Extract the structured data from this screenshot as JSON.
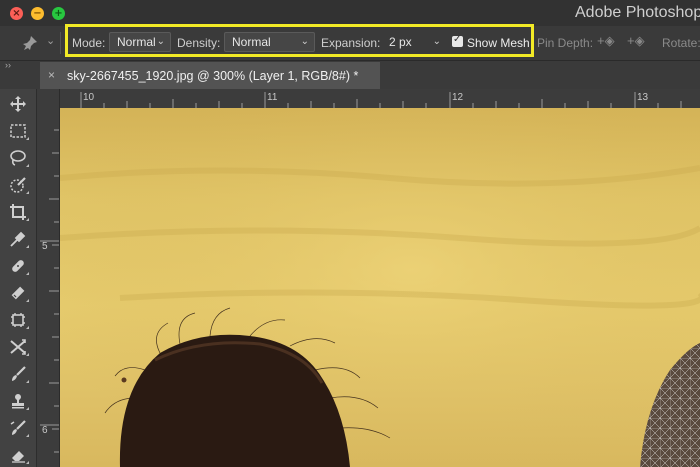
{
  "window": {
    "title": "Adobe Photoshop C"
  },
  "options_bar": {
    "mode_label": "Mode:",
    "mode_value": "Normal",
    "density_label": "Density:",
    "density_value": "Normal",
    "expansion_label": "Expansion:",
    "expansion_value": "2 px",
    "show_mesh_label": "Show Mesh",
    "show_mesh_checked": true,
    "pin_depth_label": "Pin Depth:",
    "rotate_label": "Rotate:",
    "highlight_color": "#f2ea26"
  },
  "document_tab": {
    "close_glyph": "×",
    "title": "sky-2667455_1920.jpg @ 300% (Layer 1, RGB/8#) *"
  },
  "rulers": {
    "horizontal": [
      "10",
      "11",
      "12",
      "13"
    ],
    "vertical": [
      "5",
      "6"
    ]
  },
  "tools": [
    "move-icon",
    "marquee-icon",
    "lasso-icon",
    "quick-select-icon",
    "crop-icon",
    "eyedropper-icon",
    "spot-healing-icon",
    "brush-icon",
    "clone-stamp-icon",
    "history-brush-icon",
    "content-aware-move-icon",
    "paint-brush-icon",
    "stamp-icon",
    "mixer-brush-icon",
    "eraser-icon"
  ],
  "colors": {
    "canvas_sky": "#e3c76a",
    "panel_bg": "#424242",
    "hair": "#2a1a12"
  }
}
